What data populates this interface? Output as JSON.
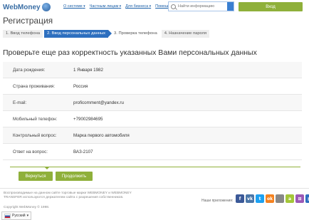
{
  "header": {
    "logo_text": "WebMoney",
    "nav": [
      "О системе",
      "Частным лицам",
      "Для бизнеса",
      "Помощь"
    ],
    "search_placeholder": "Найти информацию",
    "login_label": "Вход"
  },
  "page_title": "Регистрация",
  "steps": [
    {
      "label": "1. Ввод телефона",
      "active": false
    },
    {
      "label": "2. Ввод персональных данных",
      "active": true
    },
    {
      "label": "3. Проверка телефона",
      "active": false
    },
    {
      "label": "4. Назначение пароля",
      "active": false
    }
  ],
  "heading": "Проверьте еще раз корректность указанных Вами персональных данных",
  "fields": [
    {
      "label": "Дата рождения:",
      "value": "1 Января 1982"
    },
    {
      "label": "Страна проживания:",
      "value": "Россия"
    },
    {
      "label": "E-mail:",
      "value": "proficomment@yandex.ru"
    },
    {
      "label": "Мобильный телефон:",
      "value": "+79002984695"
    },
    {
      "label": "Контрольный вопрос:",
      "value": "Марка первого автомобиля"
    },
    {
      "label": "Ответ на вопрос:",
      "value": "ВАЗ-2107"
    }
  ],
  "buttons": {
    "back": "Вернуться",
    "next": "Продолжить"
  },
  "footer": {
    "disclaimer": "Воспроизводимые на данном сайте торговые марки WEBMONEY и WEBMONEY TRANSFER используются держателем сайта с разрешения собственников.",
    "copyright": "Copyright WebMoney © 1998.",
    "apps_label": "Наши приложения:",
    "apps": [
      {
        "name": "facebook-icon",
        "glyph": "f",
        "color": "#3b5998"
      },
      {
        "name": "vk-icon",
        "glyph": "vk",
        "color": "#4a76a8"
      },
      {
        "name": "twitter-icon",
        "glyph": "t",
        "color": "#1da1f2"
      },
      {
        "name": "odnoklassniki-icon",
        "glyph": "ok",
        "color": "#f58220"
      },
      {
        "name": "apple-icon",
        "glyph": "",
        "color": "#888888"
      },
      {
        "name": "android-icon",
        "glyph": "a",
        "color": "#a4c639"
      },
      {
        "name": "windows-icon",
        "glyph": "⊞",
        "color": "#9b59b6"
      },
      {
        "name": "grid-icon",
        "glyph": "▦",
        "color": "#2f6fbf"
      }
    ],
    "language": "Русский"
  },
  "colors": {
    "accent_green": "#8fb03a",
    "accent_blue": "#2d6fbf"
  }
}
